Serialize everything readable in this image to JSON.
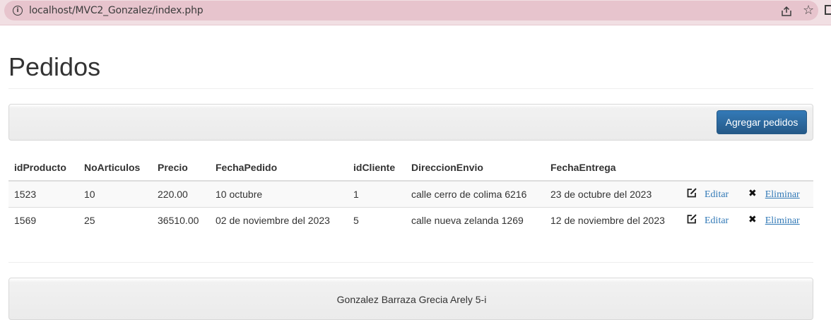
{
  "browser": {
    "url": "localhost/MVC2_Gonzalez/index.php",
    "info_glyph": "i",
    "star_glyph": "☆"
  },
  "page": {
    "title": "Pedidos",
    "add_button_label": "Agregar pedidos"
  },
  "table": {
    "headers": [
      "idProducto",
      "NoArticulos",
      "Precio",
      "FechaPedido",
      "idCliente",
      "DireccionEnvio",
      "FechaEntrega"
    ],
    "rows": [
      {
        "idProducto": "1523",
        "NoArticulos": "10",
        "Precio": "220.00",
        "FechaPedido": "10 octubre",
        "idCliente": "1",
        "DireccionEnvio": "calle cerro de colima 6216",
        "FechaEntrega": "23 de octubre del 2023",
        "edit_label": "Editar",
        "delete_label": "Eliminar"
      },
      {
        "idProducto": "1569",
        "NoArticulos": "25",
        "Precio": "36510.00",
        "FechaPedido": "02 de noviembre del 2023",
        "idCliente": "5",
        "DireccionEnvio": "calle nueva zelanda 1269",
        "FechaEntrega": "12 de noviembre del 2023",
        "edit_label": "Editar",
        "delete_label": "Eliminar"
      }
    ],
    "delete_glyph": "✖"
  },
  "footer": {
    "text": "Gonzalez Barraza Grecia Arely 5-i"
  },
  "colors": {
    "primary_button": "#337ab7",
    "link": "#337ab7",
    "browser_bar": "#f1dfe3"
  }
}
